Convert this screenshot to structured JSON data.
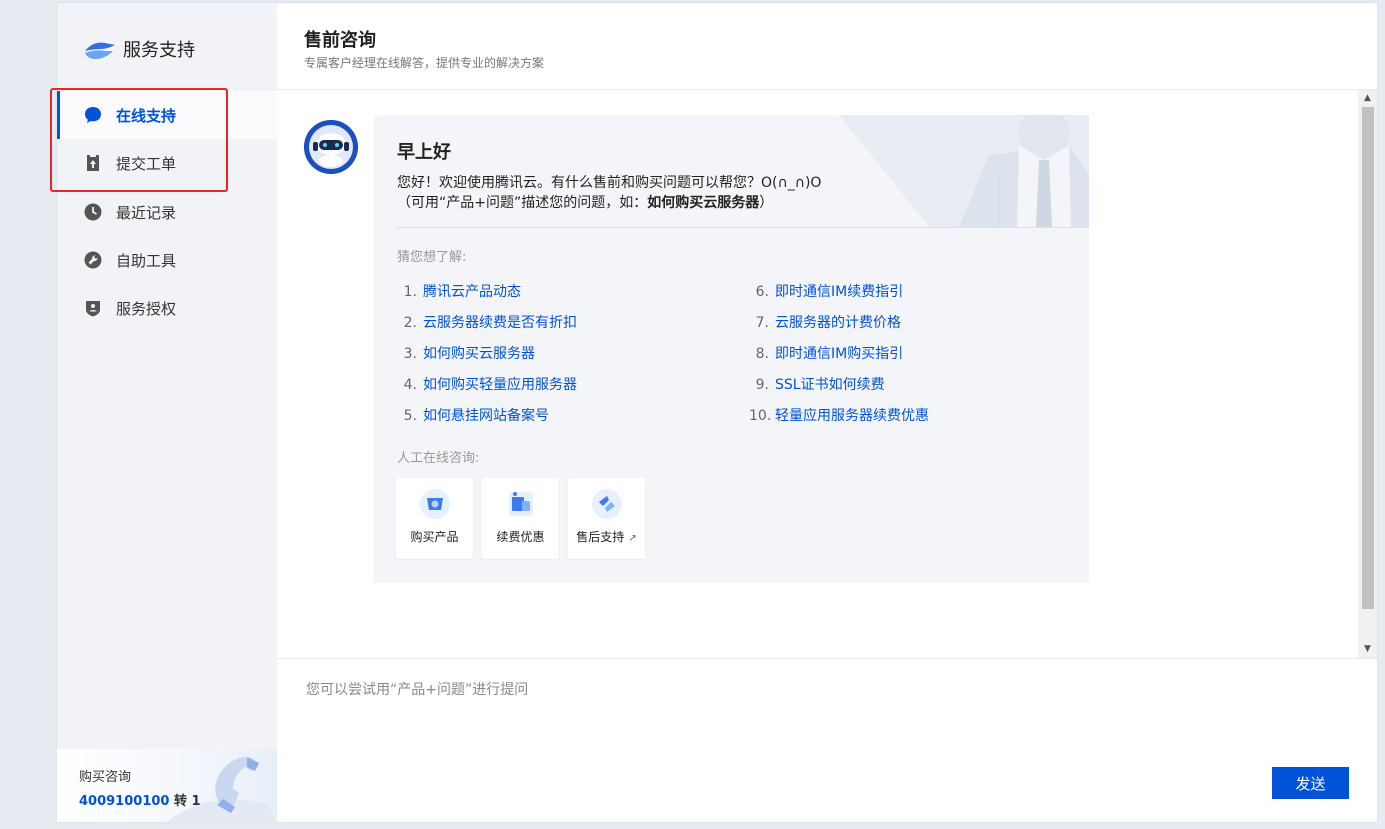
{
  "sidebar": {
    "brand_title": "服务支持",
    "items": [
      {
        "label": "在线支持",
        "icon": "chat-bubble-icon",
        "active": true
      },
      {
        "label": "提交工单",
        "icon": "ticket-icon",
        "active": false
      },
      {
        "label": "最近记录",
        "icon": "clock-icon",
        "active": false
      },
      {
        "label": "自助工具",
        "icon": "wrench-icon",
        "active": false
      },
      {
        "label": "服务授权",
        "icon": "shield-icon",
        "active": false
      }
    ],
    "phone": {
      "title": "购买咨询",
      "number": "4009100100",
      "ext": "转 1"
    }
  },
  "header": {
    "title": "售前咨询",
    "subtitle": "专属客户经理在线解答，提供专业的解决方案"
  },
  "chat": {
    "greeting": "早上好",
    "welcome": "您好！欢迎使用腾讯云。有什么售前和购买问题可以帮您？O(∩_∩)O",
    "hint_prefix": "（可用“产品+问题”描述您的问题，如：",
    "hint_example": "如何购买云服务器",
    "hint_suffix": "）",
    "guess_label": "猜您想了解:",
    "questions": [
      {
        "num": "1.",
        "text": "腾讯云产品动态"
      },
      {
        "num": "2.",
        "text": "云服务器续费是否有折扣"
      },
      {
        "num": "3.",
        "text": "如何购买云服务器"
      },
      {
        "num": "4.",
        "text": "如何购买轻量应用服务器"
      },
      {
        "num": "5.",
        "text": "如何悬挂网站备案号"
      },
      {
        "num": "6.",
        "text": "即时通信IM续费指引"
      },
      {
        "num": "7.",
        "text": "云服务器的计费价格"
      },
      {
        "num": "8.",
        "text": "即时通信IM购买指引"
      },
      {
        "num": "9.",
        "text": "SSL证书如何续费"
      },
      {
        "num": "10.",
        "text": "轻量应用服务器续费优惠"
      }
    ],
    "manual_label": "人工在线咨询:",
    "services": [
      {
        "label": "购买产品",
        "icon": "cart-icon"
      },
      {
        "label": "续费优惠",
        "icon": "coupon-icon"
      },
      {
        "label": "售后支持",
        "icon": "support-icon"
      }
    ]
  },
  "input": {
    "placeholder": "您可以尝试用“产品+问题”进行提问",
    "send_label": "发送"
  },
  "colors": {
    "accent": "#0052d9",
    "highlight": "#e5252a"
  }
}
